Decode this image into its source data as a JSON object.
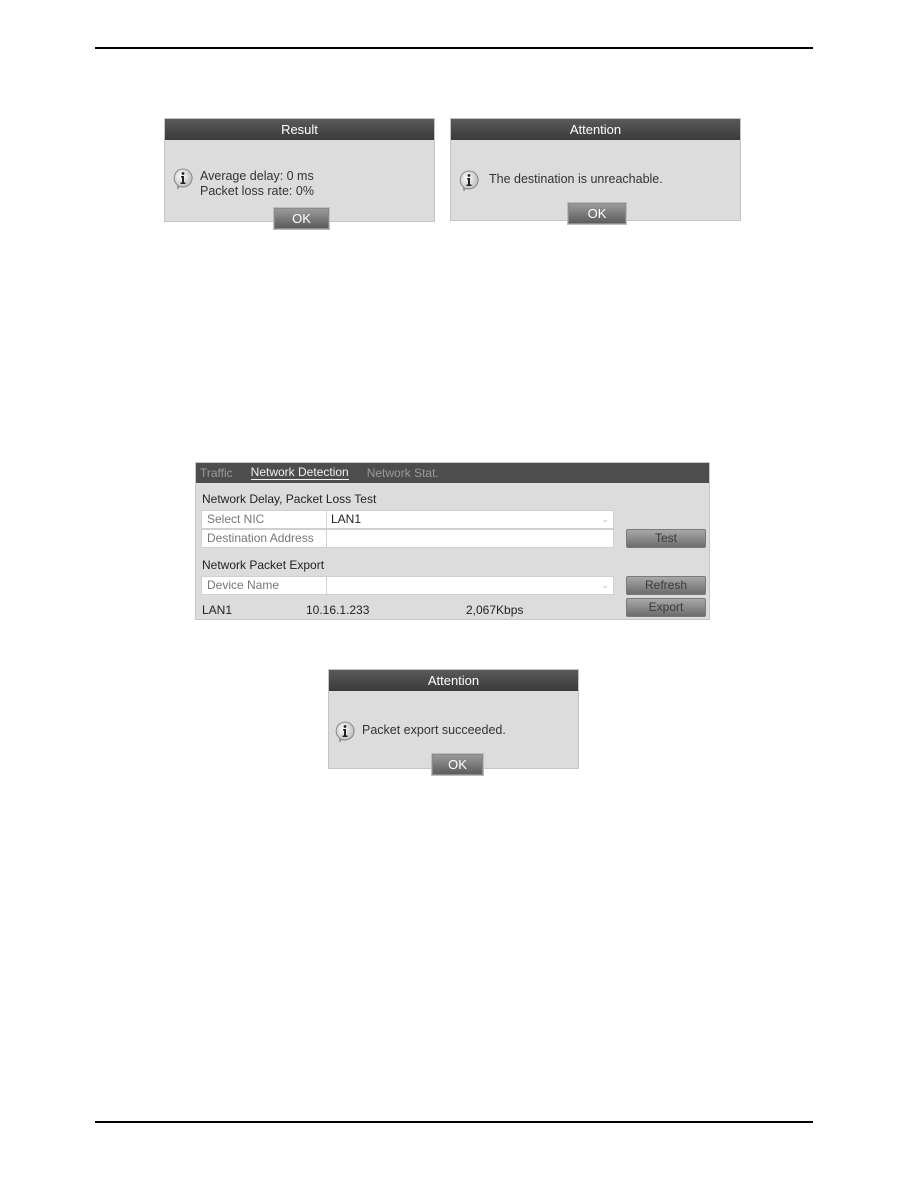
{
  "dialogs": {
    "result": {
      "title": "Result",
      "line1": "Average delay: 0 ms",
      "line2": "Packet loss rate: 0%",
      "ok_label": "OK"
    },
    "unreachable": {
      "title": "Attention",
      "message": "The destination is unreachable.",
      "ok_label": "OK"
    },
    "export_success": {
      "title": "Attention",
      "message": "Packet export succeeded.",
      "ok_label": "OK"
    }
  },
  "network_panel": {
    "tabs": [
      {
        "label": "Traffic",
        "active": false
      },
      {
        "label": "Network Detection",
        "active": true
      },
      {
        "label": "Network Stat.",
        "active": false
      }
    ],
    "delay_test": {
      "title": "Network Delay, Packet Loss Test",
      "select_nic_label": "Select NIC",
      "select_nic_value": "LAN1",
      "destination_label": "Destination Address",
      "destination_value": "",
      "test_button": "Test"
    },
    "packet_export": {
      "title": "Network Packet Export",
      "device_name_label": "Device Name",
      "device_name_value": "",
      "refresh_button": "Refresh",
      "export_button": "Export",
      "nic": "LAN1",
      "ip": "10.16.1.233",
      "rate": "2,067Kbps"
    }
  },
  "icons": {
    "info": "info-icon",
    "dropdown": "chevron-down-icon"
  }
}
